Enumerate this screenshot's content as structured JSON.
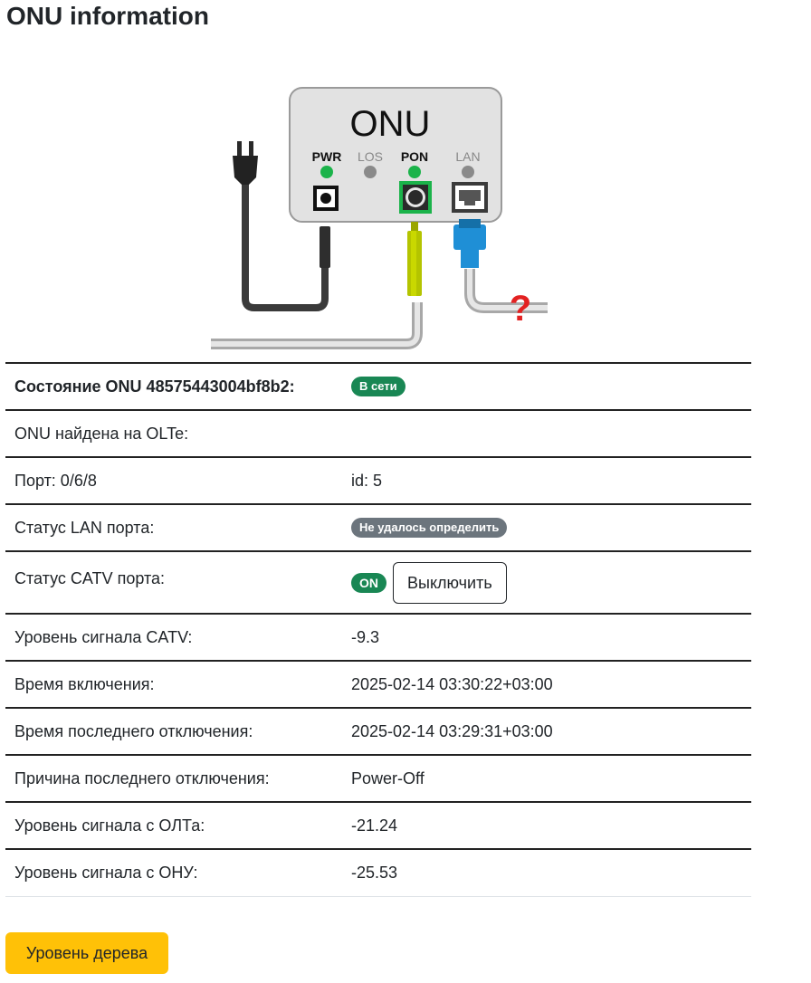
{
  "page": {
    "title": "ONU information"
  },
  "diagram": {
    "device_label": "ONU",
    "leds": [
      {
        "label": "PWR",
        "color": "#1bb34a",
        "label_color": "#111111"
      },
      {
        "label": "LOS",
        "color": "#8a8a8a",
        "label_color": "#888888"
      },
      {
        "label": "PON",
        "color": "#1bb34a",
        "label_color": "#111111"
      },
      {
        "label": "LAN",
        "color": "#8a8a8a",
        "label_color": "#888888"
      }
    ],
    "question_mark": "?"
  },
  "table": {
    "state_label": "Состояние ONU 48575443004bf8b2:",
    "state_badge": "В сети",
    "found_label": "ONU найдена на OLTe:",
    "port_label": "Порт: 0/6/8",
    "port_id": "id: 5",
    "lan_label": "Статус LAN порта:",
    "lan_badge": "Не удалось определить",
    "catv_label": "Статус CATV порта:",
    "catv_badge": "ON",
    "catv_button": "Выключить",
    "catv_level_label": "Уровень сигнала CATV:",
    "catv_level_value": "-9.3",
    "uptime_label": "Время включения:",
    "uptime_value": "2025-02-14 03:30:22+03:00",
    "last_down_label": "Время последнего отключения:",
    "last_down_value": "2025-02-14 03:29:31+03:00",
    "down_reason_label": "Причина последнего отключения:",
    "down_reason_value": "Power-Off",
    "olt_rx_label": "Уровень сигнала с ОЛТа:",
    "olt_rx_value": "-21.24",
    "onu_rx_label": "Уровень сигнала с ОНУ:",
    "onu_rx_value": "-25.53"
  },
  "tree_button": "Уровень дерева",
  "colors": {
    "success": "#198754",
    "secondary": "#6c757d",
    "warning": "#ffc107"
  }
}
